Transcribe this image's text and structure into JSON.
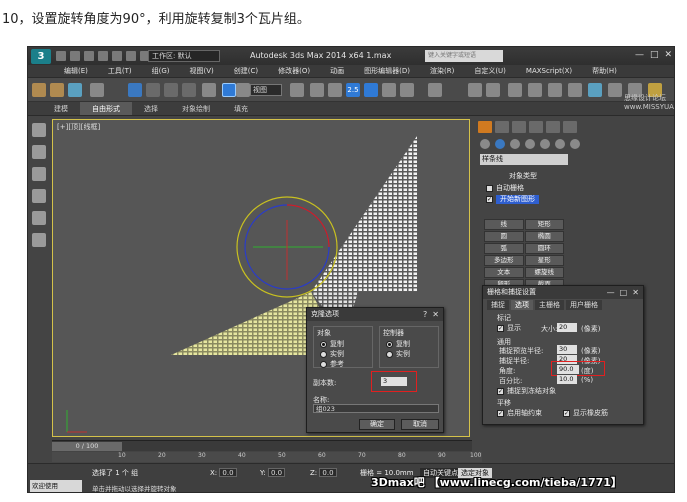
{
  "caption": "10，设置旋转角度为90°，利用旋转复制3个瓦片组。",
  "app": {
    "logo": "3",
    "workspace": "工作区: 默认",
    "title": "Autodesk 3ds Max  2014 x64     1.max",
    "search_placeholder": "键入关键字或短语",
    "watermark_bbs": "思缘设计论坛  www.MISSYUAN.com",
    "window_controls": [
      "—",
      "□",
      "✕"
    ]
  },
  "menu": [
    "编辑(E)",
    "工具(T)",
    "组(G)",
    "视图(V)",
    "创建(C)",
    "修改器(O)",
    "动画",
    "图形编辑器(D)",
    "渲染(R)",
    "自定义(U)",
    "MAXScript(X)",
    "帮助(H)"
  ],
  "toolbar": {
    "view_select": "视图",
    "numbers": "2.5"
  },
  "ribbon": {
    "tabs": [
      "建模",
      "自由形式",
      "选择",
      "对象绘制",
      "填充"
    ],
    "active": "自由形式"
  },
  "viewport": {
    "label": "[+][顶][线框]"
  },
  "command_panel": {
    "dropdown": "样条线",
    "rollout_object_type": "对象类型",
    "auto_grid": "自动栅格",
    "start_new_shape": "开始新图形",
    "object_types": [
      "线",
      "矩形",
      "圆",
      "椭圆",
      "弧",
      "圆环",
      "多边形",
      "星形",
      "文本",
      "螺旋线",
      "卵形",
      "截面"
    ],
    "rollout_name_color": "名称和颜色"
  },
  "grid_dialog": {
    "title": "栅格和捕捉设置",
    "tabs": [
      "捕捉",
      "选项",
      "主栅格",
      "用户栅格"
    ],
    "marker_group": "标记",
    "show_label": "显示",
    "size_label": "大小:",
    "size_value": "20",
    "size_unit": "(像素)",
    "general_group": "通用",
    "snap_preview_label": "捕捉预览半径:",
    "snap_preview_value": "30",
    "snap_preview_unit": "(像素)",
    "snap_radius_label": "捕捉半径:",
    "snap_radius_value": "20",
    "snap_radius_unit": "(像素)",
    "angle_label": "角度:",
    "angle_value": "90.0",
    "angle_unit": "(度)",
    "percent_label": "百分比:",
    "percent_value": "10.0",
    "percent_unit": "(%)",
    "snap_frozen": "捕捉到冻结对象",
    "translation_group": "平移",
    "axis_constraint": "启用轴约束",
    "show_rubber_band": "显示橡皮筋"
  },
  "clone_dialog": {
    "title": "克隆选项",
    "object_group": "对象",
    "object_options": [
      "复制",
      "实例",
      "参考"
    ],
    "controller_group": "控制器",
    "controller_options": [
      "复制",
      "实例"
    ],
    "copies_label": "副本数:",
    "copies_value": "3",
    "name_label": "名称:",
    "name_value": "组023",
    "ok": "确定",
    "cancel": "取消"
  },
  "timeline": {
    "frame": "0 / 100"
  },
  "ruler": [
    "10",
    "20",
    "30",
    "40",
    "50",
    "60",
    "70",
    "80",
    "90",
    "100"
  ],
  "status": {
    "welcome": "欢迎使用 MAXScri",
    "selected": "选择了 1 个 组",
    "hint": "单击并拖动以选择并旋转对象",
    "x_label": "X:",
    "x_value": "0.0",
    "y_label": "Y:",
    "y_value": "0.0",
    "z_label": "Z:",
    "z_value": "0.0",
    "grid": "栅格 = 10.0mm",
    "auto_key": "自动关键点",
    "selected_obj": "选定对象"
  },
  "watermark_bottom": "3Dmax吧 【www.linecg.com/tieba/1771】",
  "colors": {
    "ui_bg": "#444444",
    "viewport_bg": "#565656",
    "viewport_border": "#d4c24a",
    "highlight_blue": "#2f5fd0",
    "red_box": "#e02020",
    "tile_yellow": "#e6e6a0"
  }
}
